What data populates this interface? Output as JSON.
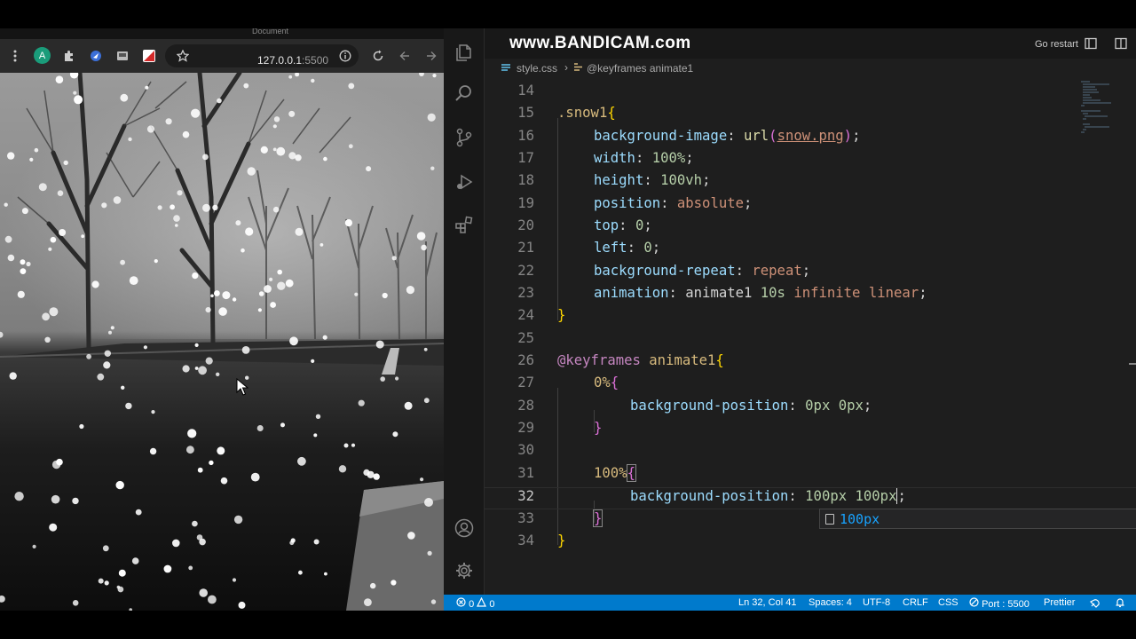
{
  "browser": {
    "tab_title": "Document",
    "profile_initial": "A",
    "url_host": "127.0.0.1",
    "url_port": ":5500"
  },
  "vscode": {
    "watermark": "www.BANDICAM.com",
    "go_restart": "Go restart",
    "breadcrumb": {
      "file": "style.css",
      "separator": "›",
      "symbol": "@keyframes animate1"
    },
    "autocomplete": "100px",
    "status": {
      "errors": "0",
      "warnings": "0",
      "position": "Ln 32, Col 41",
      "spaces": "Spaces: 4",
      "encoding": "UTF-8",
      "eol": "CRLF",
      "language": "CSS",
      "port": "Port : 5500",
      "formatter": "Prettier"
    }
  },
  "code": {
    "ln14": "14",
    "ln15": "15",
    "ln16": "16",
    "ln17": "17",
    "ln18": "18",
    "ln19": "19",
    "ln20": "20",
    "ln21": "21",
    "ln22": "22",
    "ln23": "23",
    "ln24": "24",
    "ln25": "25",
    "ln26": "26",
    "ln27": "27",
    "ln28": "28",
    "ln29": "29",
    "ln30": "30",
    "ln31": "31",
    "ln32": "32",
    "ln33": "33",
    "ln34": "34",
    "l15_sel": ".snow1",
    "l16_prop": "background-image",
    "l16_fn": "url",
    "l16_arg": "snow.png",
    "l17_prop": "width",
    "l17_val": "100%",
    "l18_prop": "height",
    "l18_val": "100vh",
    "l19_prop": "position",
    "l19_val": "absolute",
    "l20_prop": "top",
    "l20_val": "0",
    "l21_prop": "left",
    "l21_val": "0",
    "l22_prop": "background-repeat",
    "l22_val": "repeat",
    "l23_prop": "animation",
    "l23_name": "animate1",
    "l23_dur": "10s",
    "l23_iter": "infinite",
    "l23_ease": "linear",
    "l26_kw": "@keyframes",
    "l26_name": "animate1",
    "l27_sel": "0%",
    "l28_prop": "background-position",
    "l28_v1": "0px",
    "l28_v2": "0px",
    "l31_sel": "100%",
    "l32_prop": "background-position",
    "l32_v1": "100px",
    "l32_v2": "100px"
  }
}
